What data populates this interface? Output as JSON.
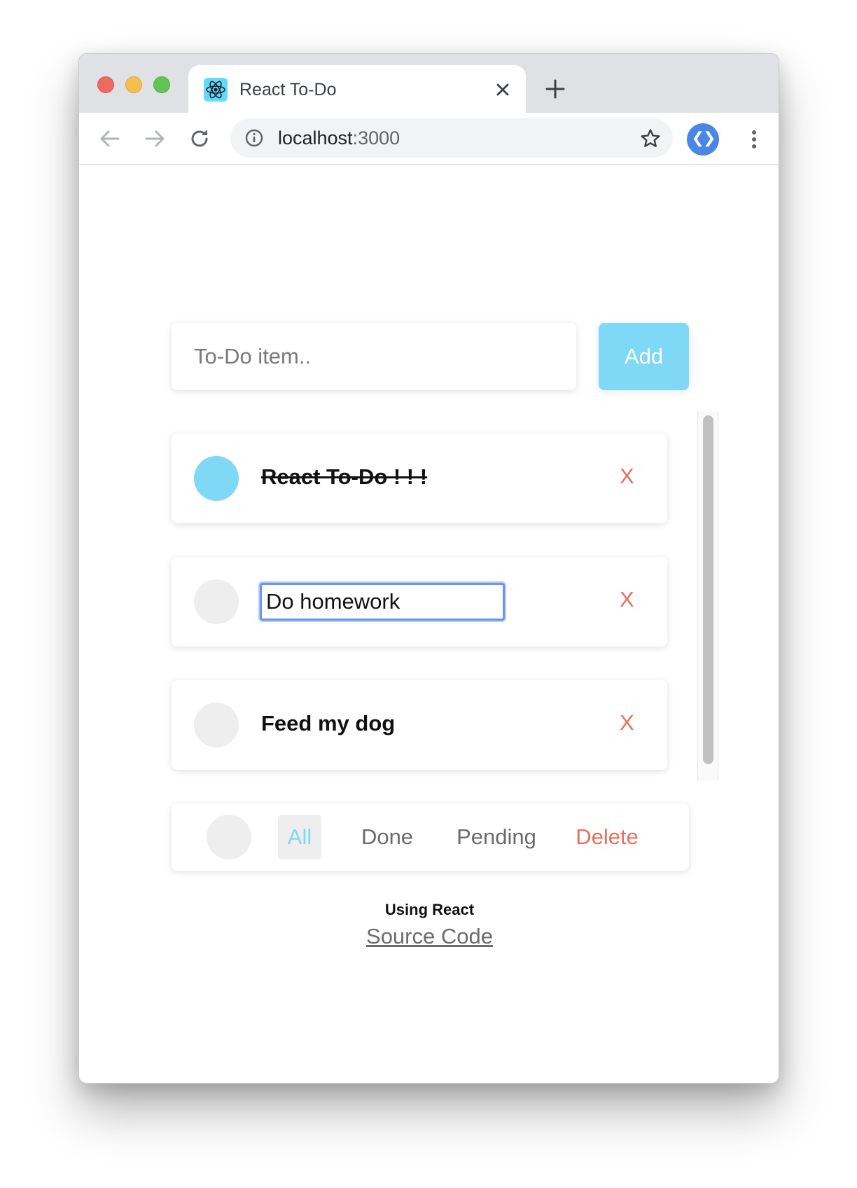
{
  "browser": {
    "tab_title": "React To-Do",
    "url_host": "localhost",
    "url_port": ":3000",
    "extension_label": "❮❯"
  },
  "app": {
    "input_placeholder": "To-Do item..",
    "add_label": "Add",
    "items": [
      {
        "text": "React To-Do ! ! !",
        "done": true,
        "editing": false,
        "delete_label": "X"
      },
      {
        "text": "Do homework",
        "done": false,
        "editing": true,
        "delete_label": "X"
      },
      {
        "text": "Feed my dog",
        "done": false,
        "editing": false,
        "delete_label": "X"
      }
    ],
    "filters": {
      "all": "All",
      "done": "Done",
      "pending": "Pending",
      "delete": "Delete",
      "active": "All"
    },
    "footer": {
      "using": "Using React",
      "source_link": "Source Code"
    }
  },
  "colors": {
    "accent": "#7fd8f6",
    "danger": "#e8705a",
    "focus_ring": "#6b95ee"
  }
}
